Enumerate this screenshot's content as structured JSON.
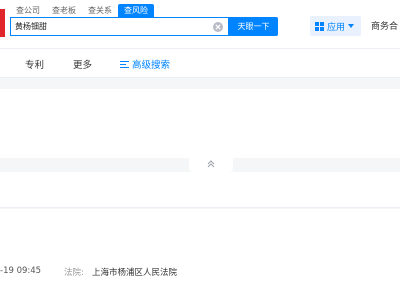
{
  "search": {
    "tabs": [
      {
        "label": "查公司",
        "active": false
      },
      {
        "label": "查老板",
        "active": false
      },
      {
        "label": "查关系",
        "active": false
      },
      {
        "label": "查风险",
        "active": true
      }
    ],
    "query": "黄杨钿甜",
    "button_label": "天眼一下"
  },
  "header": {
    "apps_label": "应用",
    "business_label": "商务合"
  },
  "nav": {
    "patent": "专利",
    "more": "更多",
    "advanced": "高级搜索"
  },
  "result": {
    "date": "-19 09:45",
    "court_label": "法院:",
    "court_value": "上海市杨浦区人民法院"
  },
  "colors": {
    "accent": "#0084ff",
    "brand": "#e0252b"
  }
}
